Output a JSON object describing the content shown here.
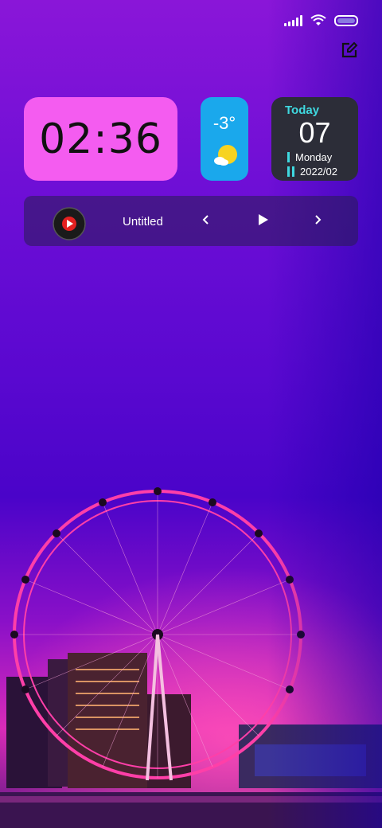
{
  "clock": {
    "time": "02:36"
  },
  "weather": {
    "temperature": "-3°",
    "condition_icon": "partly-sunny-icon"
  },
  "date_widget": {
    "label": "Today",
    "day": "07",
    "weekday": "Monday",
    "year_month": "2022/02"
  },
  "music": {
    "title": "Untitled",
    "album_icon": "music-app-icon"
  },
  "colors": {
    "clock_bg": "#f45cf0",
    "weather_bg": "#1aa8ec",
    "date_bg": "#2c2d38",
    "date_accent": "#3fd9e0"
  }
}
